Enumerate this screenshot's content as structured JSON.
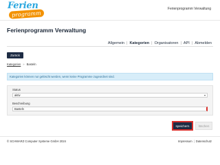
{
  "brand": {
    "logo_top": "Ferien",
    "logo_bottom": "programm",
    "primary_color": "#2aa7df",
    "accent_color": "#f39200"
  },
  "header": {
    "top_title": "Ferienprogramm Verwaltung",
    "page_title": "Ferienprogramm Verwaltung"
  },
  "nav": {
    "items": [
      {
        "label": "Allgemein",
        "active": false
      },
      {
        "label": "Kategorien",
        "active": true
      },
      {
        "label": "Organisatoren",
        "active": false
      },
      {
        "label": "API",
        "active": false
      },
      {
        "label": "Abmelden",
        "active": false
      }
    ],
    "separator": "|"
  },
  "toolbar": {
    "back_label": "Zurück"
  },
  "breadcrumb": {
    "items": [
      "Kategorien",
      "Basteln"
    ],
    "separator": "»"
  },
  "info": {
    "message": "Kategorien können nur gelöscht werden, wenn keine Programme zugeordnet sind."
  },
  "form": {
    "status_label": "Status",
    "status_value": "aktiv",
    "description_label": "Beschreibung",
    "description_value": "Basteln",
    "save_label": "speichern",
    "cancel_label": "löschen"
  },
  "footer": {
    "copyright": "© SCHWARZ Computer Systeme GmbH 2024",
    "links": [
      "Impressum",
      "Datenschutz"
    ],
    "separator": "|"
  },
  "colors": {
    "dark_navy": "#1e2c44",
    "info_bg": "#d7edf9",
    "error_red": "#d9302c"
  }
}
